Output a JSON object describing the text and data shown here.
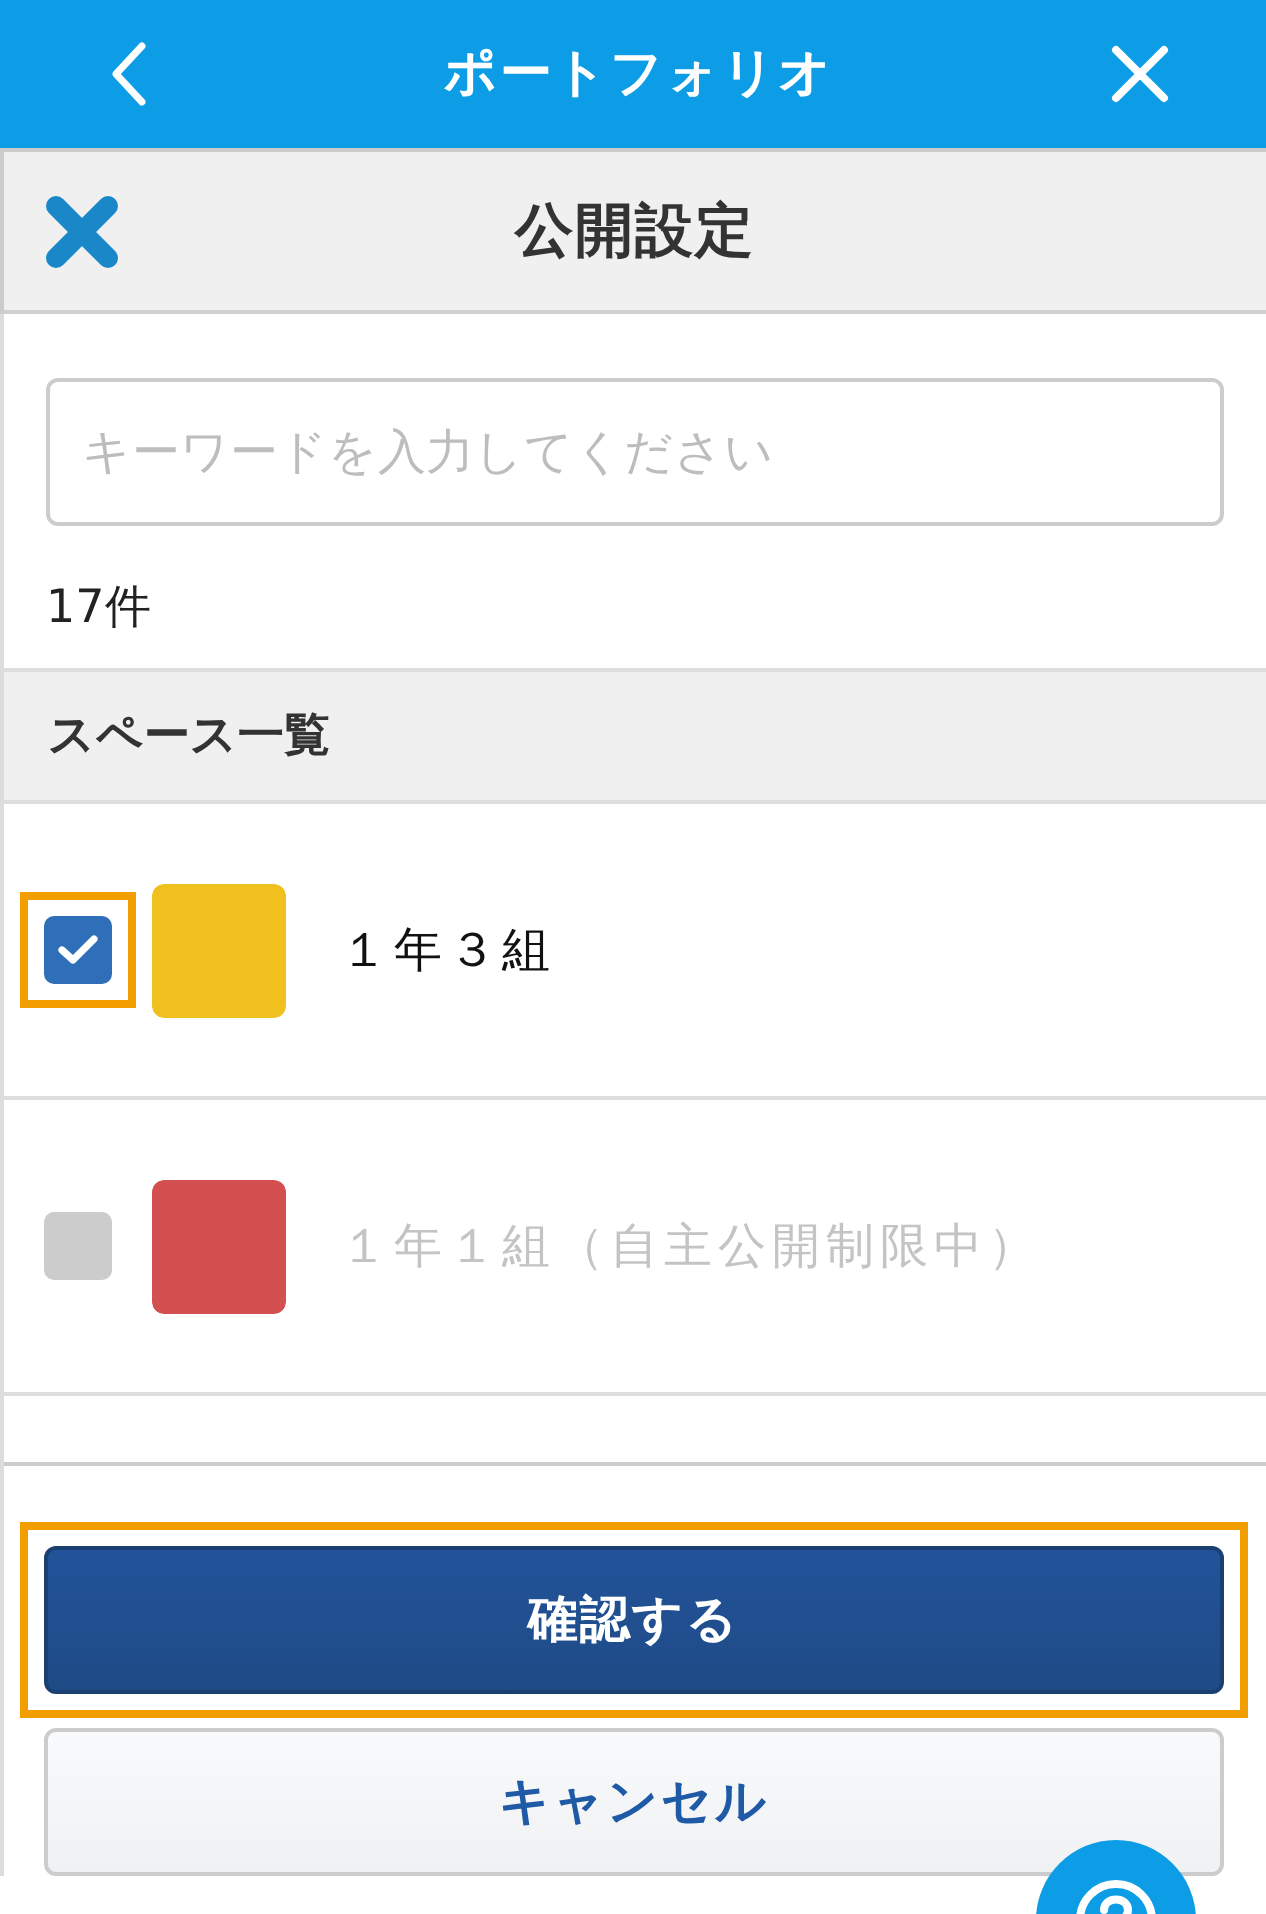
{
  "top_bar": {
    "title": "ポートフォリオ"
  },
  "dialog": {
    "title": "公開設定"
  },
  "search": {
    "placeholder": "キーワードを入力してください"
  },
  "result_count": "17件",
  "section": {
    "title": "スペース一覧"
  },
  "spaces": [
    {
      "name": "１年３組",
      "checked": true,
      "disabled": false,
      "highlighted": true,
      "color": "#f0c01e"
    },
    {
      "name": "１年１組（自主公開制限中）",
      "checked": false,
      "disabled": true,
      "highlighted": false,
      "color": "#d45050"
    }
  ],
  "buttons": [
    {
      "kind": "primary",
      "label": "確認する",
      "highlighted": true
    },
    {
      "kind": "secondary",
      "label": "キャンセル",
      "highlighted": false
    }
  ]
}
